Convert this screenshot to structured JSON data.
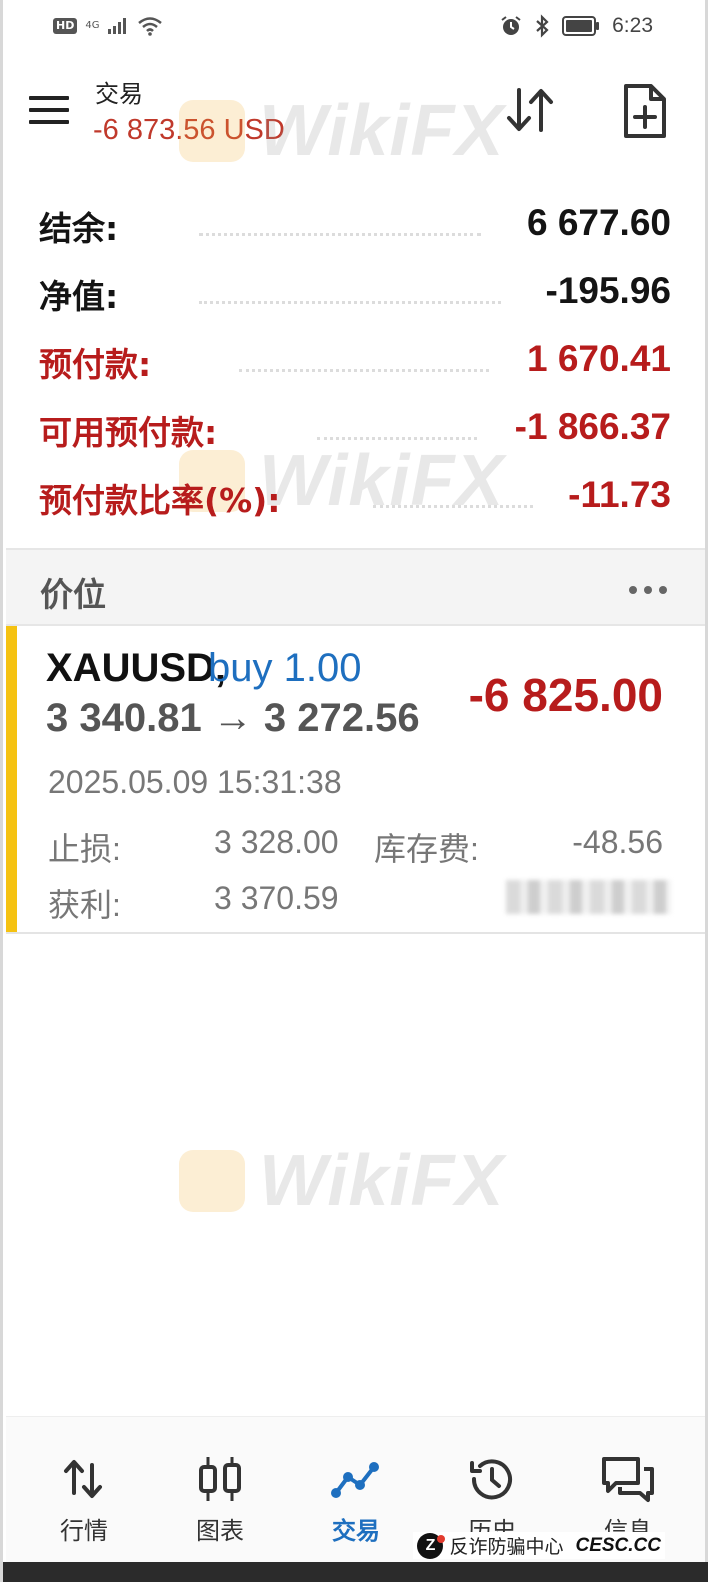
{
  "status_bar": {
    "hd": "HD",
    "network": "4G",
    "time": "6:23"
  },
  "header": {
    "title": "交易",
    "balance_change": "-6 873.56 USD"
  },
  "summary": [
    {
      "label": "结余:",
      "value": "6 677.60",
      "color": "#141414"
    },
    {
      "label": "净值:",
      "value": "-195.96",
      "color": "#141414"
    },
    {
      "label": "预付款:",
      "value": "1 670.41",
      "color": "#b71c1c"
    },
    {
      "label": "可用预付款:",
      "value": "-1 866.37",
      "color": "#b71c1c"
    },
    {
      "label": "预付款比率(%):",
      "value": "-11.73",
      "color": "#b71c1c"
    }
  ],
  "section": {
    "title": "价位"
  },
  "position": {
    "symbol": "XAUUSD,",
    "side": "buy 1.00",
    "prices": "3 340.81 → 3 272.56",
    "profit": "-6 825.00",
    "timestamp": "2025.05.09 15:31:38",
    "stop_loss_label": "止损:",
    "stop_loss_value": "3 328.00",
    "swap_label": "库存费:",
    "swap_value": "-48.56",
    "take_profit_label": "获利:",
    "take_profit_value": "3 370.59"
  },
  "watermark": "WikiFX",
  "nav": [
    {
      "label": "行情",
      "icon": "quotes-arrows-icon",
      "active": false
    },
    {
      "label": "图表",
      "icon": "chart-candles-icon",
      "active": false
    },
    {
      "label": "交易",
      "icon": "trade-line-icon",
      "active": true
    },
    {
      "label": "历史",
      "icon": "history-clock-icon",
      "active": false
    },
    {
      "label": "信息",
      "icon": "messages-icon",
      "active": false
    }
  ],
  "footer": {
    "logo": "Z",
    "text": "反诈防骗中心",
    "site": "CESC.CC"
  },
  "colors": {
    "accent": "#1e6fbf",
    "loss": "#b71c1c",
    "position_bar": "#f5c211"
  }
}
